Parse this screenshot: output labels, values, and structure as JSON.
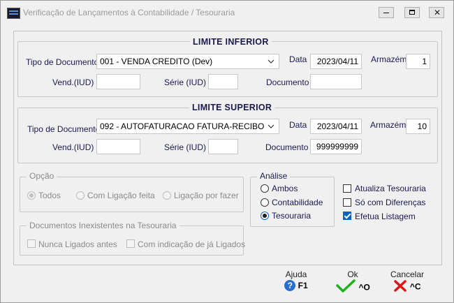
{
  "window": {
    "title": "Verificação de Lançamentos à Contabilidade / Tesouraria",
    "controls": {
      "minimize": "minimize",
      "maximize": "maximize",
      "close": "close"
    }
  },
  "limite_inferior": {
    "header": "LIMITE INFERIOR",
    "tipo_documento_label": "Tipo de Documento",
    "tipo_documento_value": "001 - VENDA CREDITO (Dev)",
    "data_label": "Data",
    "data_value": "2023/04/11",
    "armazem_label": "Armazém",
    "armazem_value": "1",
    "vend_label": "Vend.(IUD)",
    "vend_value": "",
    "serie_label": "Série (IUD)",
    "serie_value": "",
    "documento_label": "Documento",
    "documento_value": ""
  },
  "limite_superior": {
    "header": "LIMITE SUPERIOR",
    "tipo_documento_label": "Tipo de Documento",
    "tipo_documento_value": "092 - AUTOFATURACAO FATURA-RECIBO",
    "data_label": "Data",
    "data_value": "2023/04/11",
    "armazem_label": "Armazém",
    "armazem_value": "10",
    "vend_label": "Vend.(IUD)",
    "vend_value": "",
    "serie_label": "Série (IUD)",
    "serie_value": "",
    "documento_label": "Documento",
    "documento_value": "999999999"
  },
  "opcao": {
    "legend": "Opção",
    "options": [
      "Todos",
      "Com Ligação feita",
      "Ligação por fazer"
    ],
    "selected": "Todos"
  },
  "documentos_inexistentes": {
    "legend": "Documentos Inexistentes na Tesouraria",
    "nunca_ligados": "Nunca Ligados antes",
    "com_indicacao": "Com indicação de já Ligados"
  },
  "analise": {
    "legend": "Análise",
    "options": [
      "Ambos",
      "Contabilidade",
      "Tesouraria"
    ],
    "selected": "Tesouraria"
  },
  "checks": {
    "atualiza_tesouraria": "Atualiza Tesouraria",
    "so_com_diferencas": "Só com Diferenças",
    "efetua_listagem": "Efetua Listagem"
  },
  "buttons": {
    "ajuda": {
      "label": "Ajuda",
      "key": "F1"
    },
    "ok": {
      "label": "Ok",
      "key": "^O"
    },
    "cancelar": {
      "label": "Cancelar",
      "key": "^C"
    }
  },
  "colors": {
    "accent": "#0b62c4",
    "ok_green": "#1fb21f",
    "cancel_red": "#e01515",
    "help_blue": "#2a6ed0"
  }
}
